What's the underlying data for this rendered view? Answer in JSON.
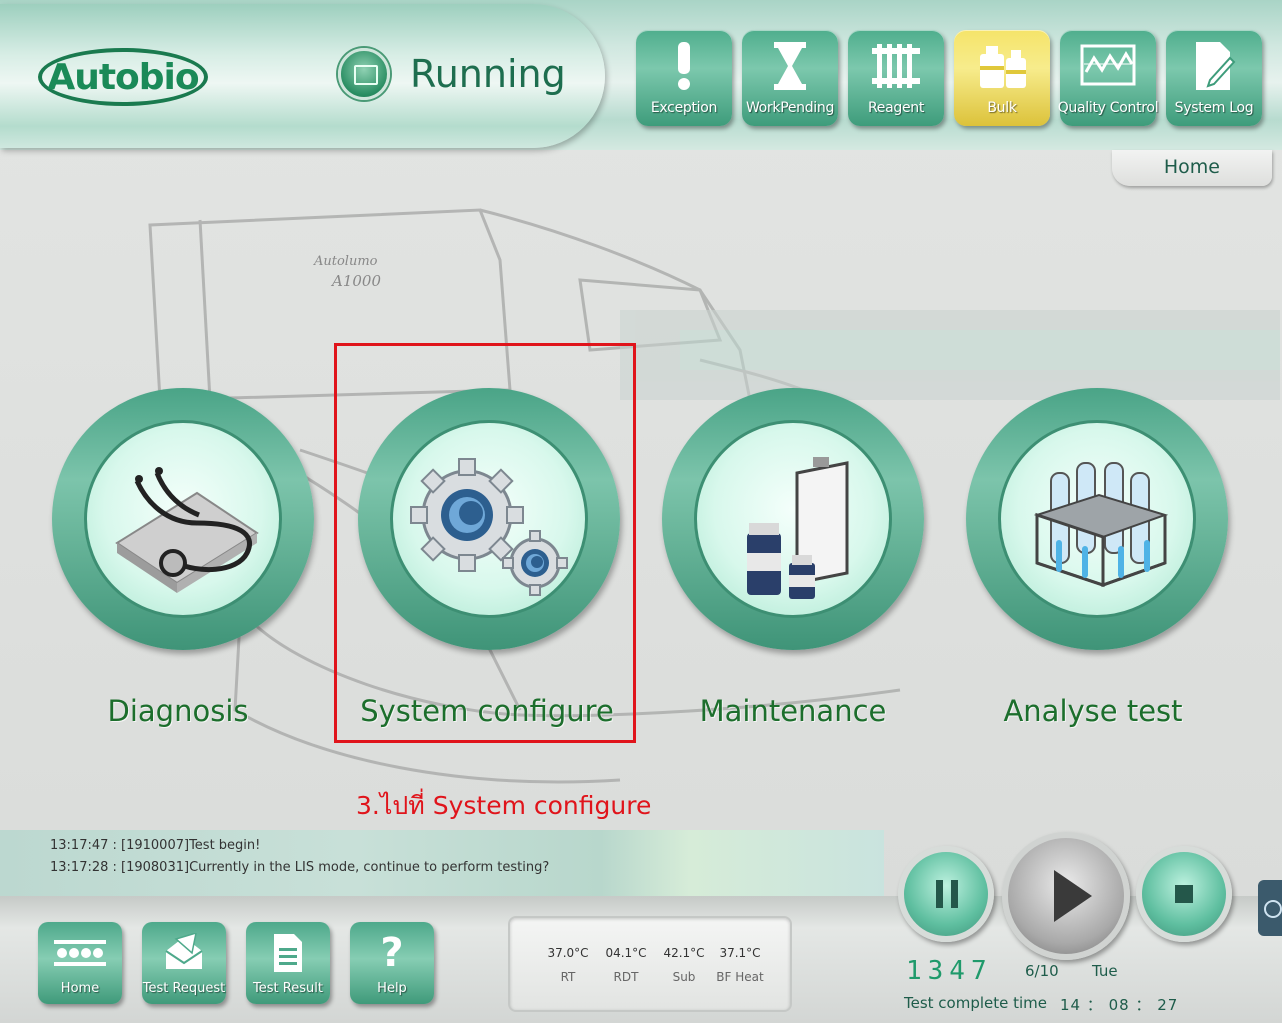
{
  "header": {
    "logo_text": "Autobio",
    "status": "Running",
    "toolbar": [
      {
        "label": "Exception",
        "icon": "exclamation-icon"
      },
      {
        "label": "WorkPending",
        "icon": "hourglass-icon"
      },
      {
        "label": "Reagent",
        "icon": "reagent-rack-icon"
      },
      {
        "label": "Bulk",
        "icon": "bulk-bottles-icon",
        "active": true
      },
      {
        "label": "Quality Control",
        "icon": "qc-chart-icon"
      },
      {
        "label": "System Log",
        "icon": "document-pen-icon"
      }
    ],
    "breadcrumb": "Home"
  },
  "background": {
    "device_brand": "Autolumo",
    "device_model": "A1000"
  },
  "modules": [
    {
      "label": "Diagnosis",
      "icon": "stethoscope-icon"
    },
    {
      "label": "System configure",
      "icon": "gears-icon"
    },
    {
      "label": "Maintenance",
      "icon": "bottles-clipboard-icon"
    },
    {
      "label": "Analyse test",
      "icon": "test-tube-rack-icon"
    }
  ],
  "annotation": {
    "text": "3.ไปที่ System configure",
    "color": "#e0141b"
  },
  "messages": [
    "13:17:47 : [1910007]Test begin!",
    "13:17:28 : [1908031]Currently in the LIS mode, continue to perform testing?"
  ],
  "bottom_nav": [
    {
      "label": "Home",
      "icon": "home-dots-icon"
    },
    {
      "label": "Test Request",
      "icon": "envelope-icon"
    },
    {
      "label": "Test Result",
      "icon": "document-icon"
    },
    {
      "label": "Help",
      "icon": "question-icon"
    }
  ],
  "temperatures": [
    {
      "value": "37.0°C",
      "label": "RT"
    },
    {
      "value": "04.1°C",
      "label": "RDT"
    },
    {
      "value": "42.1°C",
      "label": "Sub"
    },
    {
      "value": "37.1°C",
      "label": "BF Heat"
    }
  ],
  "status_bar": {
    "counter": "1347",
    "progress": "6/10",
    "weekday": "Tue",
    "complete_label": "Test complete time",
    "complete_time": "14 ： 08 ： 27"
  },
  "colors": {
    "accent": "#4aa487",
    "active_tool": "#f5e46a",
    "label_green": "#1c6e2c",
    "annotation_red": "#e0141b"
  }
}
